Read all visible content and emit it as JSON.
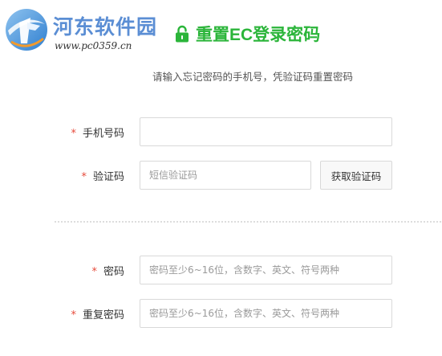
{
  "watermark": {
    "name": "河东软件园",
    "url": "www.pc0359.cn"
  },
  "header": {
    "title": "重置EC登录密码",
    "subtitle": "请输入忘记密码的手机号，凭验证码重置密码",
    "accent_color": "#2bb53a"
  },
  "form": {
    "required_mark": "*",
    "phone": {
      "label": "手机号码",
      "value": "",
      "placeholder": ""
    },
    "code": {
      "label": "验证码",
      "value": "",
      "placeholder": "短信验证码",
      "button_label": "获取验证码"
    },
    "password": {
      "label": "密码",
      "value": "",
      "placeholder": "密码至少6~16位，含数字、英文、符号两种"
    },
    "confirm_password": {
      "label": "重复密码",
      "value": "",
      "placeholder": "密码至少6~16位，含数字、英文、符号两种"
    }
  },
  "icons": {
    "title_icon": "lock-icon",
    "logo_icon": "logo-mark-icon"
  }
}
